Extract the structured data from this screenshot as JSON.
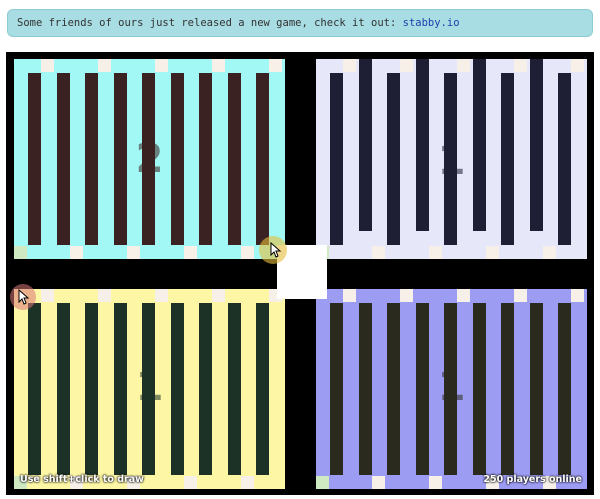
{
  "banner": {
    "text": "Some friends of ours just released a new game, check it out: ",
    "link_text": "stabby.io"
  },
  "quadrants": {
    "top_left": {
      "bg": "#a2f8f5",
      "stripe": "#3a2222",
      "digit": "2"
    },
    "top_right": {
      "bg": "#e6e7f8",
      "stripe": "#1e1e34",
      "digit": "1"
    },
    "bottom_left": {
      "bg": "#fdf6a4",
      "stripe": "#1d3226",
      "digit": "1"
    },
    "bottom_right": {
      "bg": "#9d9cf3",
      "stripe": "#2b2a1e",
      "digit": "1"
    }
  },
  "footer": {
    "hint": "Use shift+click to draw",
    "players": "250 players online"
  }
}
